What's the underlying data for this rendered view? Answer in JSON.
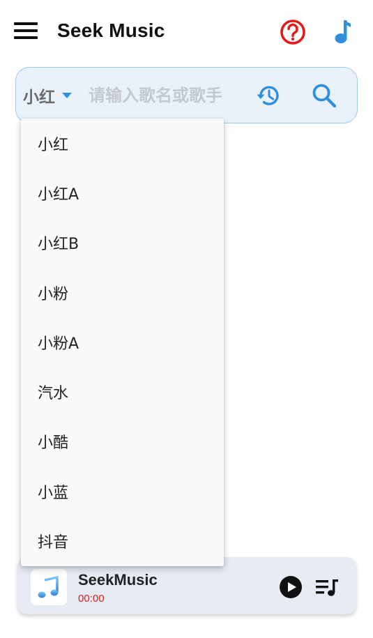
{
  "header": {
    "title": "Seek Music",
    "menu_icon": "menu-icon",
    "help_icon": "help-icon",
    "music_note_icon": "music-note-icon"
  },
  "search": {
    "source_selected": "小红",
    "placeholder": "请输入歌名或歌手",
    "value": "",
    "history_icon": "history-icon",
    "search_icon": "search-icon"
  },
  "source_options": [
    "小红",
    "小红A",
    "小红B",
    "小粉",
    "小粉A",
    "汽水",
    "小酷",
    "小蓝",
    "抖音"
  ],
  "player": {
    "title": "SeekMusic",
    "time": "00:00",
    "play_icon": "play-icon",
    "playlist_icon": "playlist-icon"
  },
  "colors": {
    "accent_blue": "#2f8fde",
    "help_red": "#e21b1b",
    "searchbar_bg": "#e9f2fb",
    "player_bg": "#e6ebf4"
  }
}
